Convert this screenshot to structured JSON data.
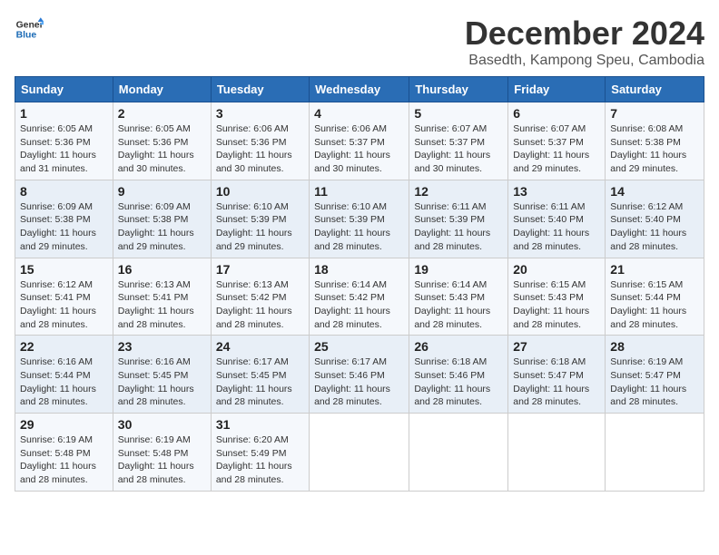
{
  "logo": {
    "line1": "General",
    "line2": "Blue"
  },
  "title": "December 2024",
  "location": "Basedth, Kampong Speu, Cambodia",
  "days_of_week": [
    "Sunday",
    "Monday",
    "Tuesday",
    "Wednesday",
    "Thursday",
    "Friday",
    "Saturday"
  ],
  "weeks": [
    [
      {
        "day": 1,
        "sunrise": "6:05 AM",
        "sunset": "5:36 PM",
        "daylight": "11 hours and 31 minutes."
      },
      {
        "day": 2,
        "sunrise": "6:05 AM",
        "sunset": "5:36 PM",
        "daylight": "11 hours and 30 minutes."
      },
      {
        "day": 3,
        "sunrise": "6:06 AM",
        "sunset": "5:36 PM",
        "daylight": "11 hours and 30 minutes."
      },
      {
        "day": 4,
        "sunrise": "6:06 AM",
        "sunset": "5:37 PM",
        "daylight": "11 hours and 30 minutes."
      },
      {
        "day": 5,
        "sunrise": "6:07 AM",
        "sunset": "5:37 PM",
        "daylight": "11 hours and 30 minutes."
      },
      {
        "day": 6,
        "sunrise": "6:07 AM",
        "sunset": "5:37 PM",
        "daylight": "11 hours and 29 minutes."
      },
      {
        "day": 7,
        "sunrise": "6:08 AM",
        "sunset": "5:38 PM",
        "daylight": "11 hours and 29 minutes."
      }
    ],
    [
      {
        "day": 8,
        "sunrise": "6:09 AM",
        "sunset": "5:38 PM",
        "daylight": "11 hours and 29 minutes."
      },
      {
        "day": 9,
        "sunrise": "6:09 AM",
        "sunset": "5:38 PM",
        "daylight": "11 hours and 29 minutes."
      },
      {
        "day": 10,
        "sunrise": "6:10 AM",
        "sunset": "5:39 PM",
        "daylight": "11 hours and 29 minutes."
      },
      {
        "day": 11,
        "sunrise": "6:10 AM",
        "sunset": "5:39 PM",
        "daylight": "11 hours and 28 minutes."
      },
      {
        "day": 12,
        "sunrise": "6:11 AM",
        "sunset": "5:39 PM",
        "daylight": "11 hours and 28 minutes."
      },
      {
        "day": 13,
        "sunrise": "6:11 AM",
        "sunset": "5:40 PM",
        "daylight": "11 hours and 28 minutes."
      },
      {
        "day": 14,
        "sunrise": "6:12 AM",
        "sunset": "5:40 PM",
        "daylight": "11 hours and 28 minutes."
      }
    ],
    [
      {
        "day": 15,
        "sunrise": "6:12 AM",
        "sunset": "5:41 PM",
        "daylight": "11 hours and 28 minutes."
      },
      {
        "day": 16,
        "sunrise": "6:13 AM",
        "sunset": "5:41 PM",
        "daylight": "11 hours and 28 minutes."
      },
      {
        "day": 17,
        "sunrise": "6:13 AM",
        "sunset": "5:42 PM",
        "daylight": "11 hours and 28 minutes."
      },
      {
        "day": 18,
        "sunrise": "6:14 AM",
        "sunset": "5:42 PM",
        "daylight": "11 hours and 28 minutes."
      },
      {
        "day": 19,
        "sunrise": "6:14 AM",
        "sunset": "5:43 PM",
        "daylight": "11 hours and 28 minutes."
      },
      {
        "day": 20,
        "sunrise": "6:15 AM",
        "sunset": "5:43 PM",
        "daylight": "11 hours and 28 minutes."
      },
      {
        "day": 21,
        "sunrise": "6:15 AM",
        "sunset": "5:44 PM",
        "daylight": "11 hours and 28 minutes."
      }
    ],
    [
      {
        "day": 22,
        "sunrise": "6:16 AM",
        "sunset": "5:44 PM",
        "daylight": "11 hours and 28 minutes."
      },
      {
        "day": 23,
        "sunrise": "6:16 AM",
        "sunset": "5:45 PM",
        "daylight": "11 hours and 28 minutes."
      },
      {
        "day": 24,
        "sunrise": "6:17 AM",
        "sunset": "5:45 PM",
        "daylight": "11 hours and 28 minutes."
      },
      {
        "day": 25,
        "sunrise": "6:17 AM",
        "sunset": "5:46 PM",
        "daylight": "11 hours and 28 minutes."
      },
      {
        "day": 26,
        "sunrise": "6:18 AM",
        "sunset": "5:46 PM",
        "daylight": "11 hours and 28 minutes."
      },
      {
        "day": 27,
        "sunrise": "6:18 AM",
        "sunset": "5:47 PM",
        "daylight": "11 hours and 28 minutes."
      },
      {
        "day": 28,
        "sunrise": "6:19 AM",
        "sunset": "5:47 PM",
        "daylight": "11 hours and 28 minutes."
      }
    ],
    [
      {
        "day": 29,
        "sunrise": "6:19 AM",
        "sunset": "5:48 PM",
        "daylight": "11 hours and 28 minutes."
      },
      {
        "day": 30,
        "sunrise": "6:19 AM",
        "sunset": "5:48 PM",
        "daylight": "11 hours and 28 minutes."
      },
      {
        "day": 31,
        "sunrise": "6:20 AM",
        "sunset": "5:49 PM",
        "daylight": "11 hours and 28 minutes."
      },
      null,
      null,
      null,
      null
    ]
  ],
  "labels": {
    "sunrise": "Sunrise:",
    "sunset": "Sunset:",
    "daylight": "Daylight:"
  }
}
